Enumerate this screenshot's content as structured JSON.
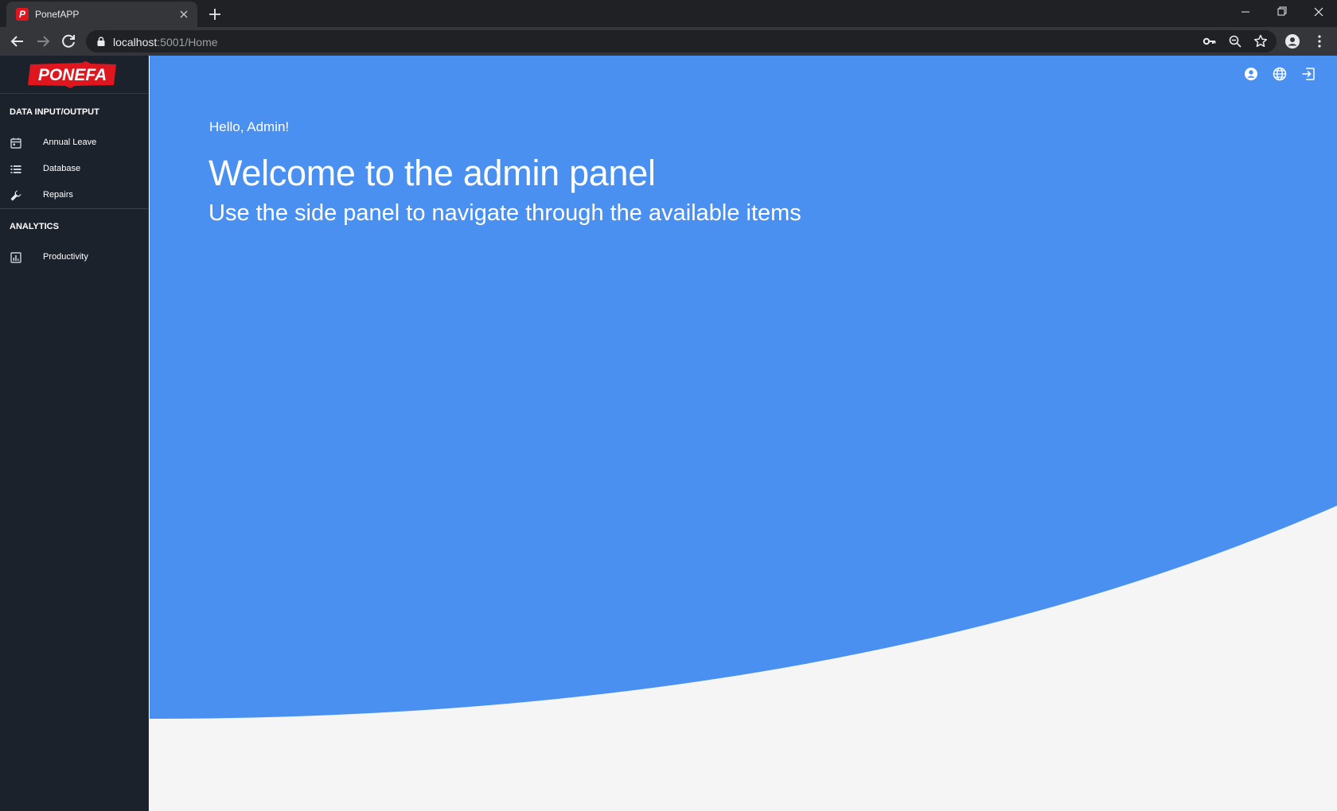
{
  "browser": {
    "tab_title": "PonefAPP",
    "favicon_letter": "P",
    "url_host": "localhost",
    "url_path": ":5001/Home"
  },
  "sidebar": {
    "logo_text": "PONEFA",
    "sections": [
      {
        "title": "DATA INPUT/OUTPUT",
        "items": [
          {
            "label": "Annual Leave",
            "icon": "calendar-icon"
          },
          {
            "label": "Database",
            "icon": "list-icon"
          },
          {
            "label": "Repairs",
            "icon": "wrench-icon"
          }
        ]
      },
      {
        "title": "ANALYTICS",
        "items": [
          {
            "label": "Productivity",
            "icon": "chart-icon"
          }
        ]
      }
    ]
  },
  "main": {
    "greeting": "Hello, Admin!",
    "headline": "Welcome to the admin panel",
    "subhead": "Use the side panel to navigate through the available items"
  },
  "topbar_icons": [
    "account-icon",
    "globe-icon",
    "logout-icon"
  ],
  "colors": {
    "hero_blue": "#4a90f0",
    "sidebar_bg": "#1c222b",
    "page_bg": "#f5f5f5",
    "brand_red": "#e0161e"
  }
}
